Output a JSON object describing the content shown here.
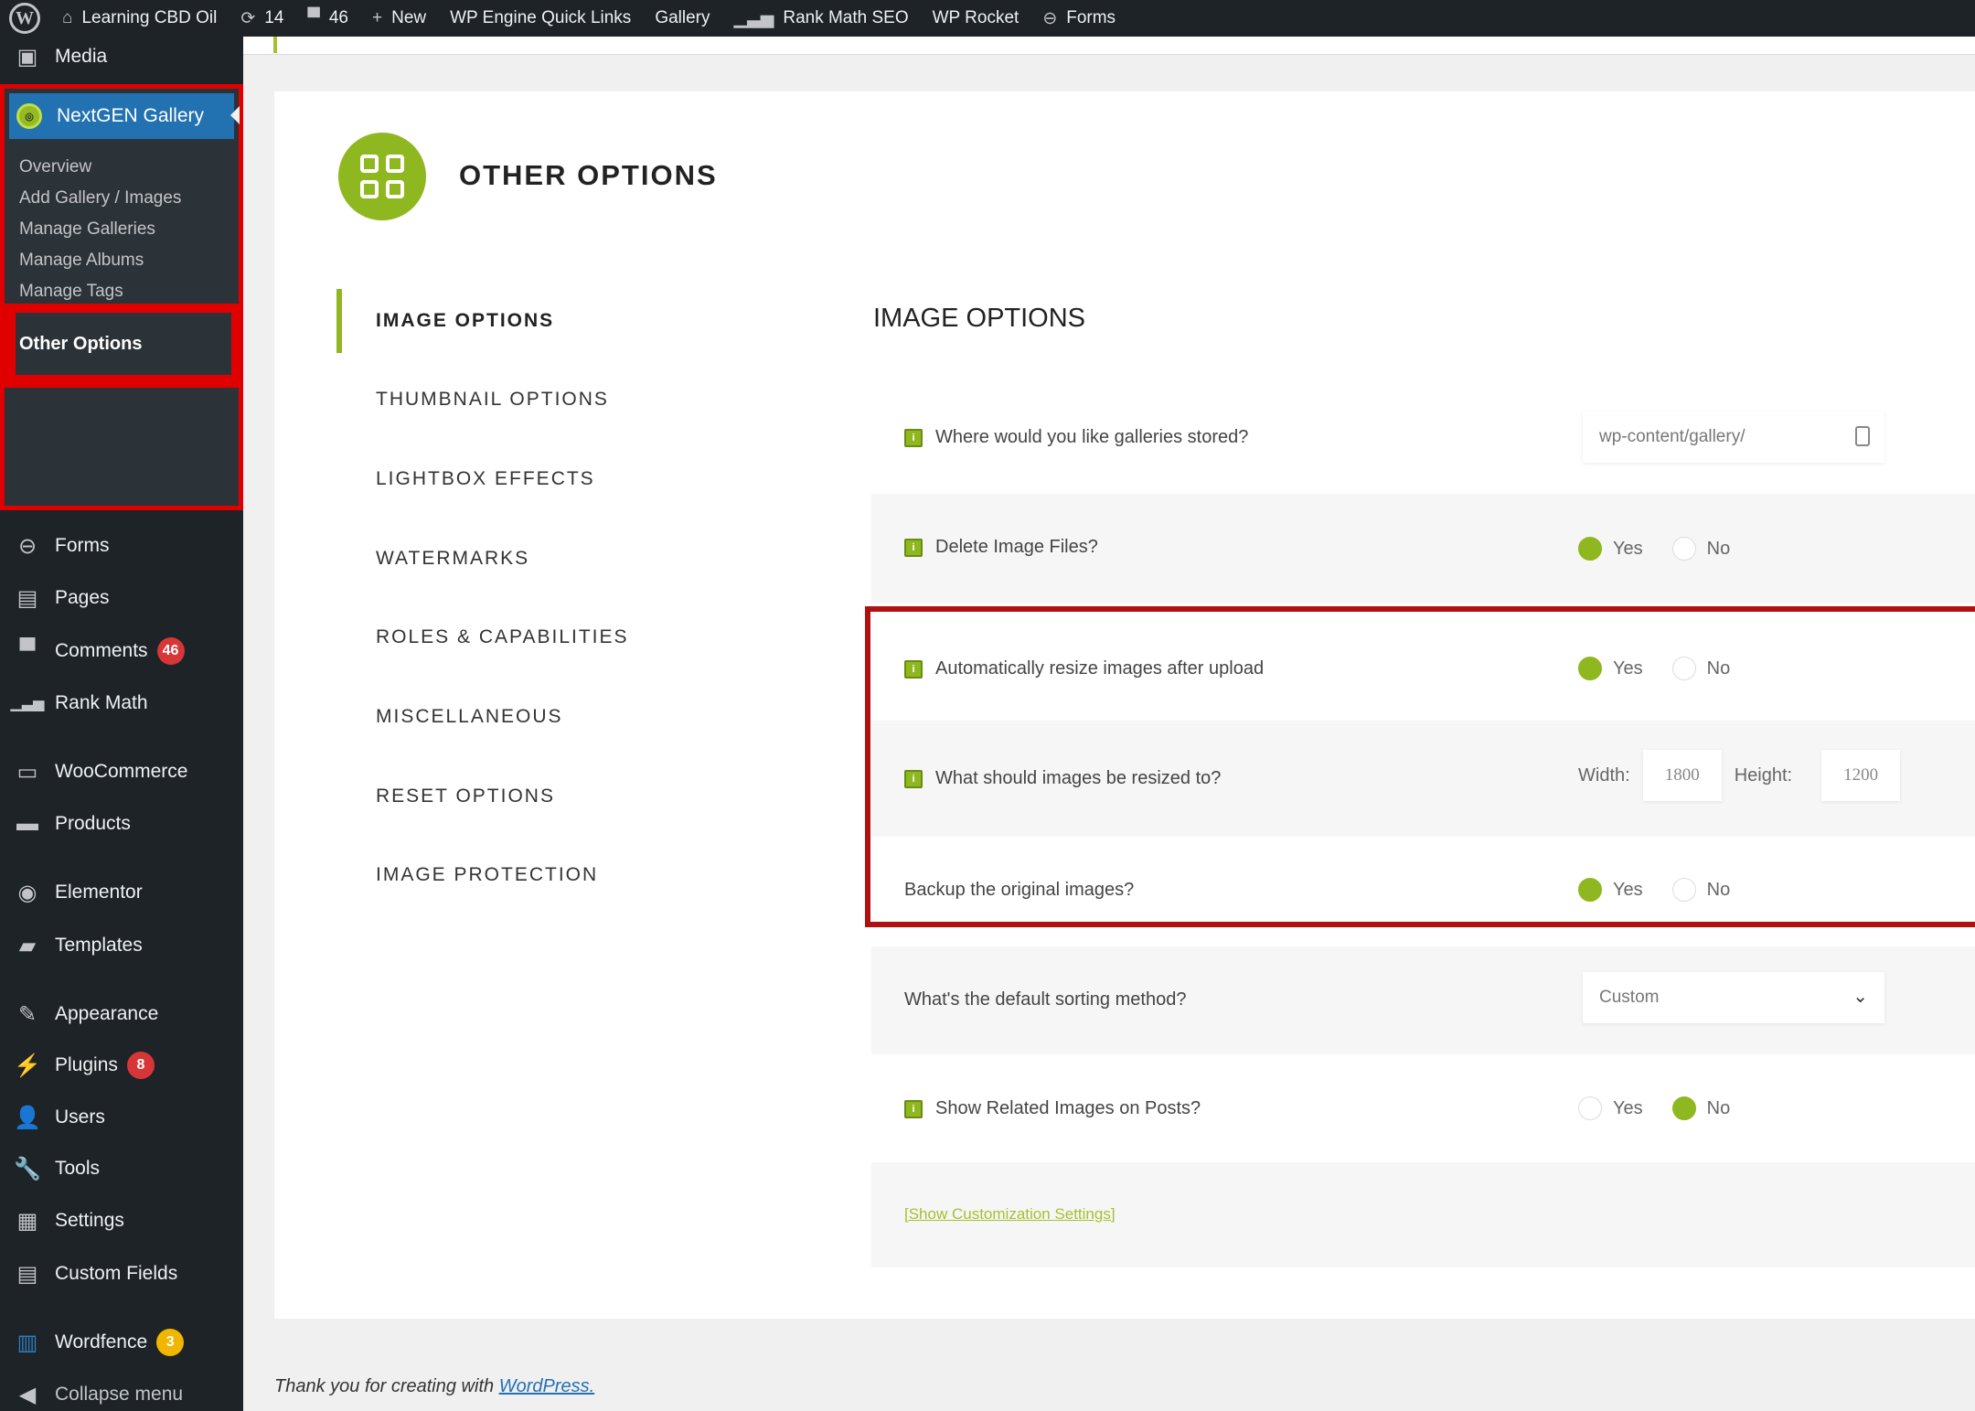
{
  "adminbar": {
    "site_name": "Learning CBD Oil",
    "updates_count": "14",
    "comments_count": "46",
    "new_label": "New",
    "items": [
      "WP Engine Quick Links",
      "Gallery",
      "Rank Math SEO",
      "WP Rocket",
      "Forms"
    ]
  },
  "sidebar": {
    "media_label": "Media",
    "nextgen_label": "NextGEN Gallery",
    "submenu": [
      "Overview",
      "Add Gallery / Images",
      "Manage Galleries",
      "Manage Albums",
      "Manage Tags"
    ],
    "active_submenu": "Other Options",
    "items": [
      {
        "label": "Forms",
        "icon": "forms-icon"
      },
      {
        "label": "Pages",
        "icon": "pages-icon"
      },
      {
        "label": "Comments",
        "icon": "comments-icon",
        "badge": "46"
      },
      {
        "label": "Rank Math",
        "icon": "rank-math-icon"
      },
      {
        "label": "WooCommerce",
        "icon": "woocommerce-icon"
      },
      {
        "label": "Products",
        "icon": "products-icon"
      },
      {
        "label": "Elementor",
        "icon": "elementor-icon"
      },
      {
        "label": "Templates",
        "icon": "templates-icon"
      },
      {
        "label": "Appearance",
        "icon": "appearance-icon"
      },
      {
        "label": "Plugins",
        "icon": "plugins-icon",
        "badge": "8"
      },
      {
        "label": "Users",
        "icon": "users-icon"
      },
      {
        "label": "Tools",
        "icon": "tools-icon"
      },
      {
        "label": "Settings",
        "icon": "settings-icon"
      },
      {
        "label": "Custom Fields",
        "icon": "custom-fields-icon"
      },
      {
        "label": "Wordfence",
        "icon": "wordfence-icon",
        "badge": "3"
      },
      {
        "label": "Collapse menu",
        "icon": "collapse-icon"
      }
    ]
  },
  "page": {
    "title": "OTHER OPTIONS",
    "tabs": [
      "IMAGE OPTIONS",
      "THUMBNAIL OPTIONS",
      "LIGHTBOX EFFECTS",
      "WATERMARKS",
      "ROLES & CAPABILITIES",
      "MISCELLANEOUS",
      "RESET OPTIONS",
      "IMAGE PROTECTION"
    ],
    "active_tab": "IMAGE OPTIONS",
    "section_title": "IMAGE OPTIONS"
  },
  "options": {
    "gallery_path": {
      "label": "Where would you like galleries stored?",
      "value": "wp-content/gallery/"
    },
    "delete_files": {
      "label": "Delete Image Files?",
      "value": "Yes"
    },
    "auto_resize": {
      "label": "Automatically resize images after upload",
      "value": "Yes"
    },
    "resize_to": {
      "label": "What should images be resized to?",
      "width_label": "Width:",
      "width": "1800",
      "height_label": "Height:",
      "height": "1200"
    },
    "backup": {
      "label": "Backup the original images?",
      "value": "Yes"
    },
    "sorting": {
      "label": "What's the default sorting method?",
      "value": "Custom"
    },
    "related": {
      "label": "Show Related Images on Posts?",
      "value": "No"
    },
    "yes_label": "Yes",
    "no_label": "No",
    "customization_link": "[Show Customization Settings]"
  },
  "footer": {
    "text": "Thank you for creating with ",
    "link": "WordPress."
  },
  "colors": {
    "accent": "#8fb820",
    "highlight": "#e00000",
    "adminbar": "#1d2327",
    "wp_blue": "#2271b1"
  }
}
